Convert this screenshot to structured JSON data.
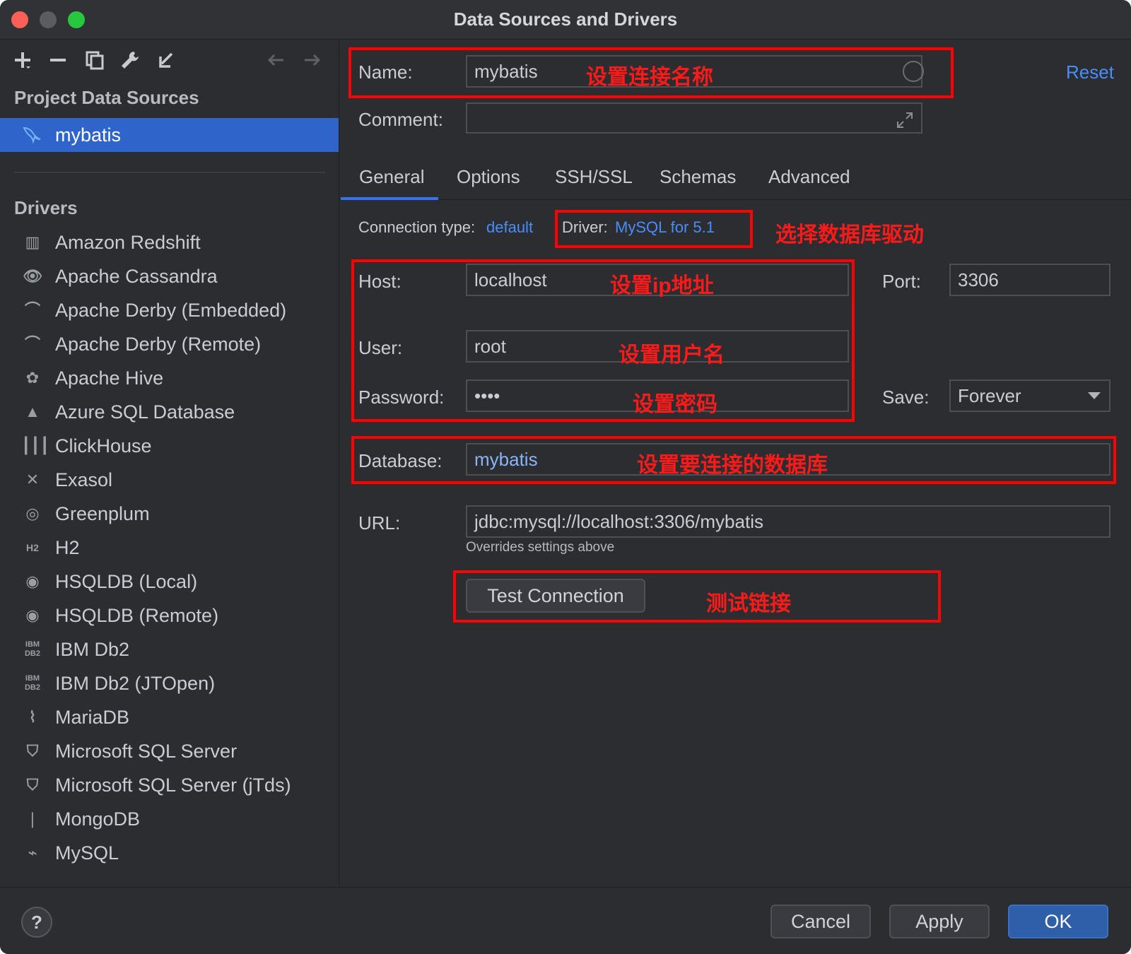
{
  "window": {
    "title": "Data Sources and Drivers"
  },
  "sidebar": {
    "project_title": "Project Data Sources",
    "selected_source": "mybatis",
    "drivers_title": "Drivers",
    "drivers": [
      {
        "label": "Amazon Redshift",
        "icon": "redshift-icon"
      },
      {
        "label": "Apache Cassandra",
        "icon": "cassandra-icon"
      },
      {
        "label": "Apache Derby (Embedded)",
        "icon": "derby-icon"
      },
      {
        "label": "Apache Derby (Remote)",
        "icon": "derby-icon"
      },
      {
        "label": "Apache Hive",
        "icon": "hive-icon"
      },
      {
        "label": "Azure SQL Database",
        "icon": "azure-icon"
      },
      {
        "label": "ClickHouse",
        "icon": "clickhouse-icon"
      },
      {
        "label": "Exasol",
        "icon": "exasol-icon"
      },
      {
        "label": "Greenplum",
        "icon": "greenplum-icon"
      },
      {
        "label": "H2",
        "icon": "h2-icon"
      },
      {
        "label": "HSQLDB (Local)",
        "icon": "hsqldb-icon"
      },
      {
        "label": "HSQLDB (Remote)",
        "icon": "hsqldb-icon"
      },
      {
        "label": "IBM Db2",
        "icon": "db2-icon"
      },
      {
        "label": "IBM Db2 (JTOpen)",
        "icon": "db2-icon"
      },
      {
        "label": "MariaDB",
        "icon": "mariadb-icon"
      },
      {
        "label": "Microsoft SQL Server",
        "icon": "sqlserver-icon"
      },
      {
        "label": "Microsoft SQL Server (jTds)",
        "icon": "sqlserver-icon"
      },
      {
        "label": "MongoDB",
        "icon": "mongodb-icon"
      },
      {
        "label": "MySQL",
        "icon": "mysql-icon"
      }
    ]
  },
  "form": {
    "name_label": "Name:",
    "name_value": "mybatis",
    "reset_label": "Reset",
    "comment_label": "Comment:",
    "comment_value": "",
    "tabs": [
      "General",
      "Options",
      "SSH/SSL",
      "Schemas",
      "Advanced"
    ],
    "connection_type_label": "Connection type:",
    "connection_type_value": "default",
    "driver_label": "Driver:",
    "driver_value": "MySQL for 5.1",
    "host_label": "Host:",
    "host_value": "localhost",
    "port_label": "Port:",
    "port_value": "3306",
    "user_label": "User:",
    "user_value": "root",
    "password_label": "Password:",
    "password_value": "••••",
    "save_label": "Save:",
    "save_value": "Forever",
    "database_label": "Database:",
    "database_value": "mybatis",
    "url_label": "URL:",
    "url_value": "jdbc:mysql://localhost:3306/mybatis",
    "url_hint": "Overrides settings above",
    "test_connection_label": "Test Connection"
  },
  "annotations": {
    "name": "设置连接名称",
    "driver": "选择数据库驱动",
    "host": "设置ip地址",
    "user": "设置用户名",
    "password": "设置密码",
    "database": "设置要连接的数据库",
    "test": "测试链接"
  },
  "footer": {
    "help": "?",
    "cancel": "Cancel",
    "apply": "Apply",
    "ok": "OK"
  },
  "colors": {
    "accent": "#3574f0",
    "link": "#4b8df8",
    "annotation": "#ff0000"
  }
}
